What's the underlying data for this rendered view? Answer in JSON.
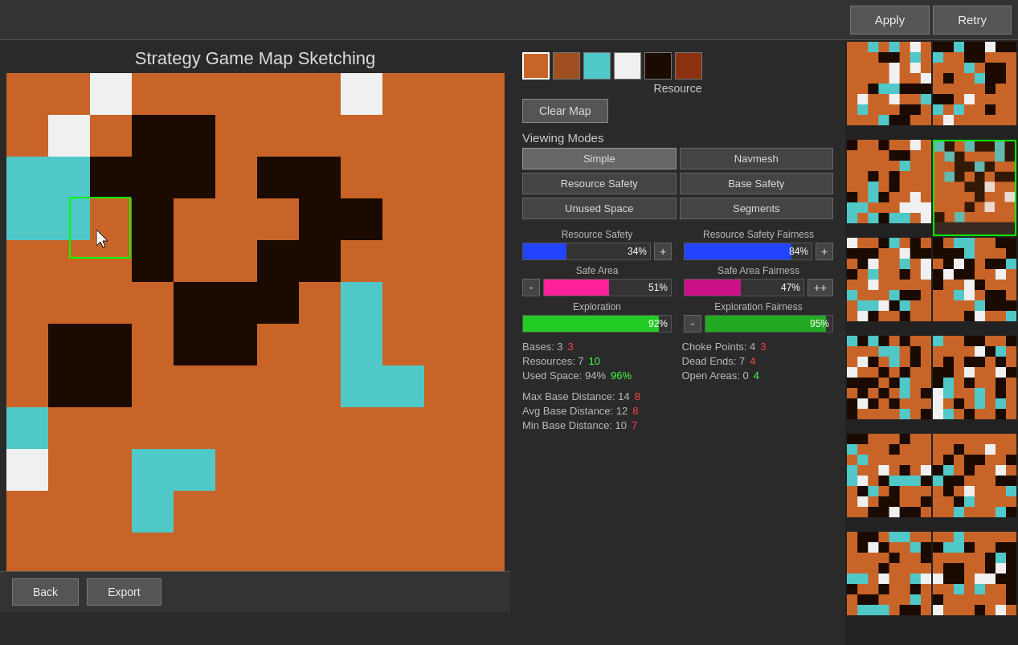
{
  "header": {
    "apply_label": "Apply",
    "retry_label": "Retry"
  },
  "title": "Strategy Game Map Sketching",
  "swatches": [
    {
      "color": "#c86428",
      "label": "orange",
      "selected": true
    },
    {
      "color": "#a05020",
      "label": "dark-orange",
      "selected": false
    },
    {
      "color": "#50c8c8",
      "label": "cyan",
      "selected": false
    },
    {
      "color": "#f0f0f0",
      "label": "white",
      "selected": false
    },
    {
      "color": "#2a1a08",
      "label": "dark-brown",
      "selected": false
    },
    {
      "color": "#8b3010",
      "label": "rust",
      "selected": false
    }
  ],
  "resource_label": "Resource",
  "clear_map_label": "Clear Map",
  "viewing_modes": {
    "label": "Viewing Modes",
    "modes": [
      {
        "id": "simple",
        "label": "Simple",
        "active": true
      },
      {
        "id": "navmesh",
        "label": "Navmesh",
        "active": false
      },
      {
        "id": "resource-safety",
        "label": "Resource Safety",
        "active": false
      },
      {
        "id": "base-safety",
        "label": "Base Safety",
        "active": false
      },
      {
        "id": "unused-space",
        "label": "Unused Space",
        "active": false
      },
      {
        "id": "segments",
        "label": "Segments",
        "active": false
      }
    ]
  },
  "stats": {
    "resource_safety": {
      "label": "Resource Safety",
      "value": 34,
      "color": "#2244ff"
    },
    "resource_safety_fairness": {
      "label": "Resource Safety Fairness",
      "value": 84,
      "color": "#2244ff"
    },
    "safe_area": {
      "label": "Safe Area",
      "value": 51,
      "color": "#ff2299"
    },
    "safe_area_fairness": {
      "label": "Safe Area Fairness",
      "value": 47,
      "color": "#cc1188"
    },
    "exploration": {
      "label": "Exploration",
      "value": 92,
      "color": "#22cc22"
    },
    "exploration_fairness": {
      "label": "Exploration Fairness",
      "value": 95,
      "color": "#22aa22"
    }
  },
  "numbers": {
    "left": [
      {
        "label": "Bases:",
        "val1": "3",
        "val2": "3",
        "val2color": "red"
      },
      {
        "label": "Resources:",
        "val1": "7",
        "val2": "10",
        "val2color": "green"
      },
      {
        "label": "Used Space:",
        "val1": "94%",
        "val2": "96%",
        "val2color": "green"
      }
    ],
    "left2": [
      {
        "label": "Max Base Distance:",
        "val1": "14",
        "val2": "8",
        "val2color": "red"
      },
      {
        "label": "Avg Base Distance:",
        "val1": "12",
        "val2": "8",
        "val2color": "red"
      },
      {
        "label": "Min Base Distance:",
        "val1": "10",
        "val2": "7",
        "val2color": "red"
      }
    ],
    "right": [
      {
        "label": "Choke Points:",
        "val1": "4",
        "val2": "3",
        "val2color": "red"
      },
      {
        "label": "Dead Ends:",
        "val1": "7",
        "val2": "4",
        "val2color": "red"
      },
      {
        "label": "Open Areas:",
        "val1": "0",
        "val2": "4",
        "val2color": "green"
      }
    ]
  },
  "bottom": {
    "back_label": "Back",
    "export_label": "Export"
  },
  "thumbnails": [
    {
      "id": 0,
      "selected": false
    },
    {
      "id": 1,
      "selected": false
    },
    {
      "id": 2,
      "selected": false
    },
    {
      "id": 3,
      "selected": true
    },
    {
      "id": 4,
      "selected": false
    },
    {
      "id": 5,
      "selected": false
    },
    {
      "id": 6,
      "selected": false
    },
    {
      "id": 7,
      "selected": false
    },
    {
      "id": 8,
      "selected": false
    },
    {
      "id": 9,
      "selected": false
    },
    {
      "id": 10,
      "selected": false
    },
    {
      "id": 11,
      "selected": false
    }
  ]
}
